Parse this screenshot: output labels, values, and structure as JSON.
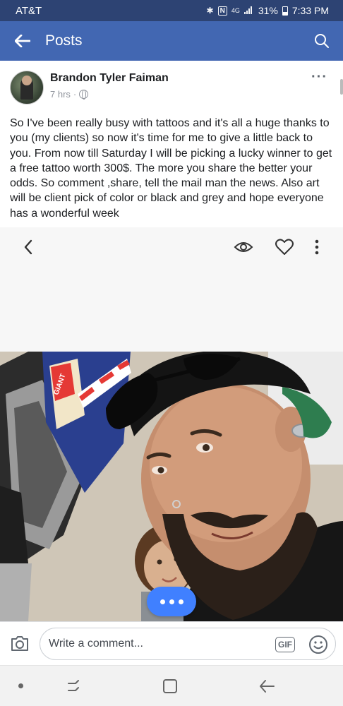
{
  "status_bar": {
    "carrier": "AT&T",
    "network": "4G",
    "battery": "31%",
    "time": "7:33 PM"
  },
  "app_bar": {
    "title": "Posts"
  },
  "post": {
    "author": "Brandon Tyler Faiman",
    "time": "7 hrs",
    "separator": "·",
    "text": "So I've been really busy with tattoos and it's all a huge thanks to you (my clients) so now it's time for me to give a little back to you. From now till Saturday I will be picking a lucky winner to get a free tattoo worth 300$. The more you share the better your odds. So comment ,share, tell the mail man the news. Also art will be client pick of color or black and grey and hope everyone has a wonderful week"
  },
  "photo_viewer": {
    "icons": [
      "back-chevron-icon",
      "eye-icon",
      "heart-icon",
      "more-vertical-icon"
    ]
  },
  "photo": {
    "poster_text": "GIANT"
  },
  "composer": {
    "placeholder": "Write a comment...",
    "gif_label": "GIF"
  },
  "colors": {
    "status_bar": "#2d4373",
    "app_bar": "#4267b2",
    "accent": "#4080ff"
  }
}
